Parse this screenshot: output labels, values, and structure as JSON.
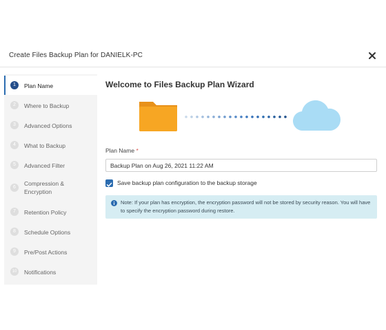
{
  "dialog": {
    "title": "Create Files Backup Plan for DANIELK-PC",
    "close_icon": "close-icon"
  },
  "sidebar": {
    "steps": [
      {
        "num": "1",
        "label": "Plan Name",
        "active": true
      },
      {
        "num": "2",
        "label": "Where to Backup"
      },
      {
        "num": "3",
        "label": "Advanced Options"
      },
      {
        "num": "4",
        "label": "What to Backup"
      },
      {
        "num": "5",
        "label": "Advanced Filter"
      },
      {
        "num": "6",
        "label": "Compression & Encryption"
      },
      {
        "num": "7",
        "label": "Retention Policy"
      },
      {
        "num": "8",
        "label": "Schedule Options"
      },
      {
        "num": "9",
        "label": "Pre/Post Actions"
      },
      {
        "num": "10",
        "label": "Notifications"
      }
    ]
  },
  "main": {
    "title": "Welcome to Files Backup Plan Wizard",
    "illustration": {
      "source_icon": "folder-icon",
      "target_icon": "cloud-icon",
      "folder_color": "#f7a623",
      "cloud_color": "#a9dcf5",
      "dots_color": "#2b6cb0"
    },
    "plan_name_label": "Plan Name",
    "required_mark": "*",
    "plan_name_value": "Backup Plan on Aug 26, 2021 11:22 AM",
    "save_config_label": "Save backup plan configuration to the backup storage",
    "save_config_checked": true,
    "note_text": "Note: If your plan has encryption, the encryption password will not be stored by security reason. You will have to specify the encryption password during restore."
  },
  "colors": {
    "accent": "#2b6cb0",
    "note_bg": "#d6edf3"
  }
}
